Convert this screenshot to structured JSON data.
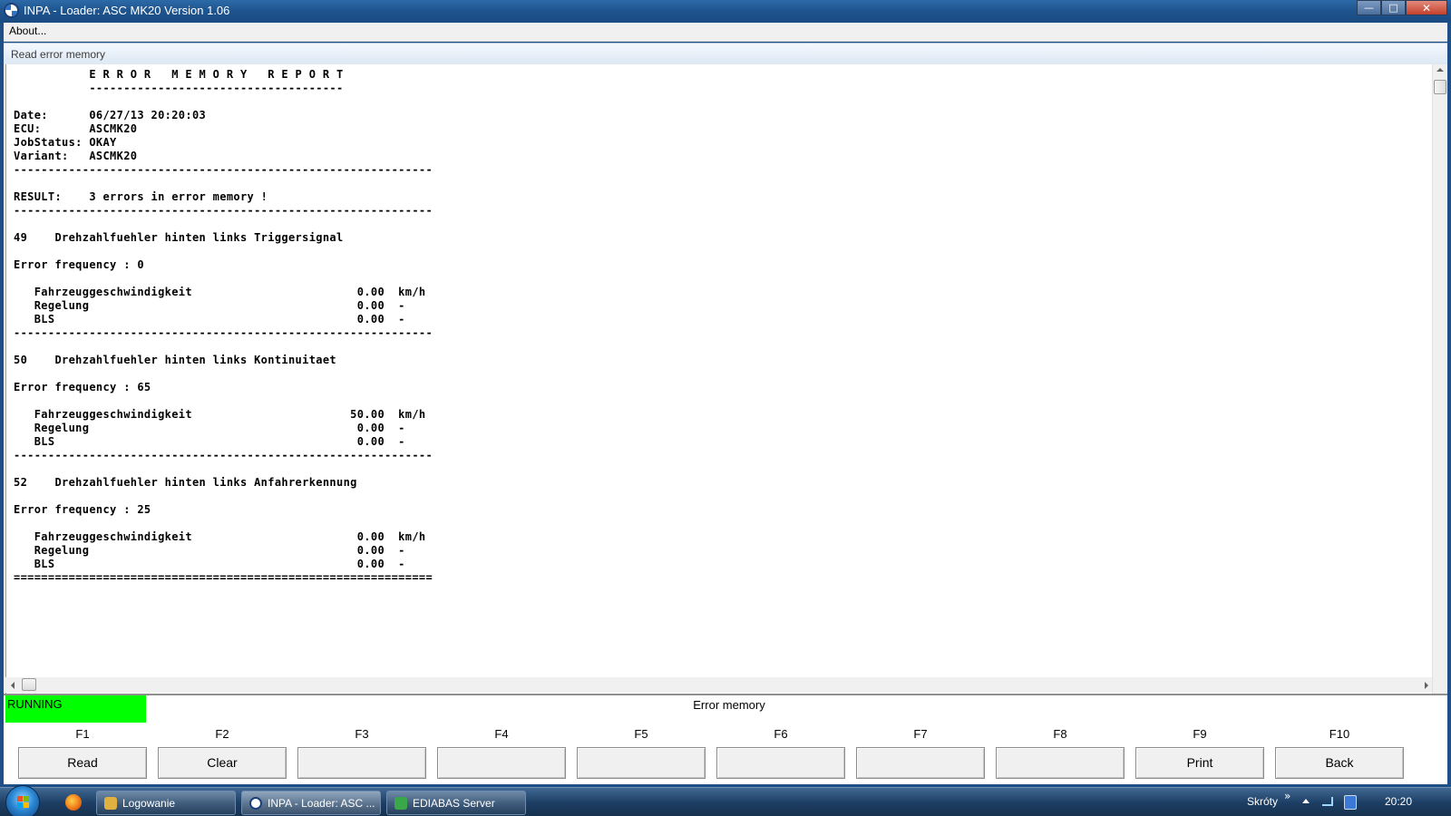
{
  "window": {
    "title": "INPA - Loader:  ASC MK20 Version 1.06"
  },
  "menu": {
    "about": "About..."
  },
  "subheader": "Read error memory",
  "report": {
    "text_lines": [
      "           E R R O R   M E M O R Y   R E P O R T",
      "           -------------------------------------",
      "",
      "Date:      06/27/13 20:20:03",
      "ECU:       ASCMK20",
      "JobStatus: OKAY",
      "Variant:   ASCMK20",
      "-------------------------------------------------------------",
      "",
      "RESULT:    3 errors in error memory !",
      "-------------------------------------------------------------",
      "",
      "49    Drehzahlfuehler hinten links Triggersignal",
      "",
      "Error frequency : 0",
      "",
      "   Fahrzeuggeschwindigkeit                        0.00  km/h",
      "   Regelung                                       0.00  -",
      "   BLS                                            0.00  -",
      "-------------------------------------------------------------",
      "",
      "50    Drehzahlfuehler hinten links Kontinuitaet",
      "",
      "Error frequency : 65",
      "",
      "   Fahrzeuggeschwindigkeit                       50.00  km/h",
      "   Regelung                                       0.00  -",
      "   BLS                                            0.00  -",
      "-------------------------------------------------------------",
      "",
      "52    Drehzahlfuehler hinten links Anfahrerkennung",
      "",
      "Error frequency : 25",
      "",
      "   Fahrzeuggeschwindigkeit                        0.00  km/h",
      "   Regelung                                       0.00  -",
      "   BLS                                            0.00  -",
      "============================================================="
    ]
  },
  "status": {
    "state": "RUNNING",
    "title": "Error memory",
    "state_color": "#00ff00"
  },
  "fkeys": [
    {
      "key": "F1",
      "label": "Read"
    },
    {
      "key": "F2",
      "label": "Clear"
    },
    {
      "key": "F3",
      "label": ""
    },
    {
      "key": "F4",
      "label": ""
    },
    {
      "key": "F5",
      "label": ""
    },
    {
      "key": "F6",
      "label": ""
    },
    {
      "key": "F7",
      "label": ""
    },
    {
      "key": "F8",
      "label": ""
    },
    {
      "key": "F9",
      "label": "Print"
    },
    {
      "key": "F10",
      "label": "Back"
    }
  ],
  "taskbar": {
    "tasks": [
      {
        "label": "Logowanie",
        "icon": "login-app-icon",
        "icon_color": "#e0b040"
      },
      {
        "label": "INPA - Loader:  ASC ...",
        "icon": "bmw-inpa-icon",
        "icon_color": "#ffffff"
      },
      {
        "label": "EDIABAS Server",
        "icon": "ediabas-icon",
        "icon_color": "#3aa84a"
      }
    ],
    "tray_label": "Skróty",
    "tray_chevron": "»",
    "clock": "20:20"
  }
}
